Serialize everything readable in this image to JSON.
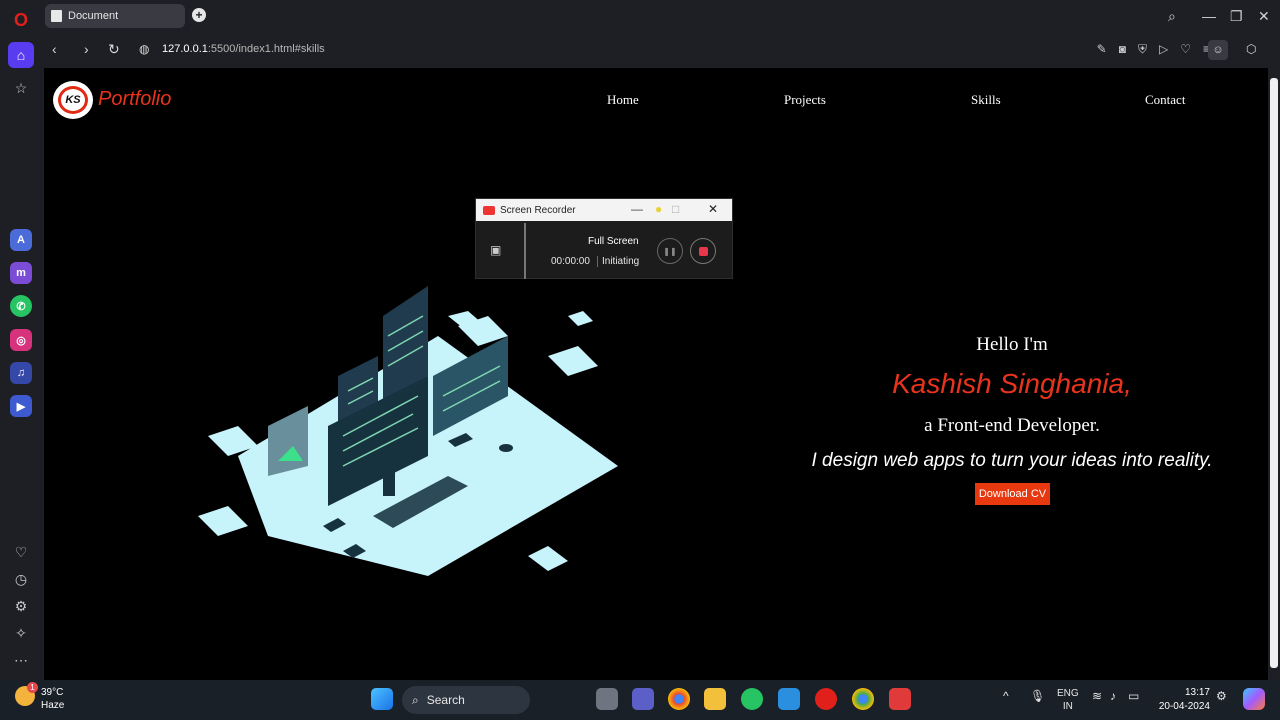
{
  "browser": {
    "tab_title": "Document",
    "url_host": "127.0.0.1",
    "url_path": ":5500/index1.html#skills"
  },
  "page": {
    "brand": "Portfolio",
    "logo_text": "KS",
    "nav": [
      "Home",
      "Projects",
      "Skills",
      "Contact"
    ],
    "hello": "Hello I'm",
    "name": "Kashish Singhania,",
    "role": "a Front-end Developer.",
    "tagline": "I design web apps to turn your ideas into reality.",
    "cta": "Download CV"
  },
  "recorder": {
    "title": "Screen Recorder",
    "mode": "Full Screen",
    "time": "00:00:00",
    "status": "Initiating"
  },
  "taskbar": {
    "weather_temp": "39°C",
    "weather_desc": "Haze",
    "weather_badge": "1",
    "search": "Search",
    "lang": "ENG",
    "region": "IN",
    "time": "13:17",
    "date": "20-04-2024"
  },
  "colors": {
    "accent": "#e8341c",
    "opera_purple": "#5a3cf0",
    "page_bg": "#000000"
  }
}
